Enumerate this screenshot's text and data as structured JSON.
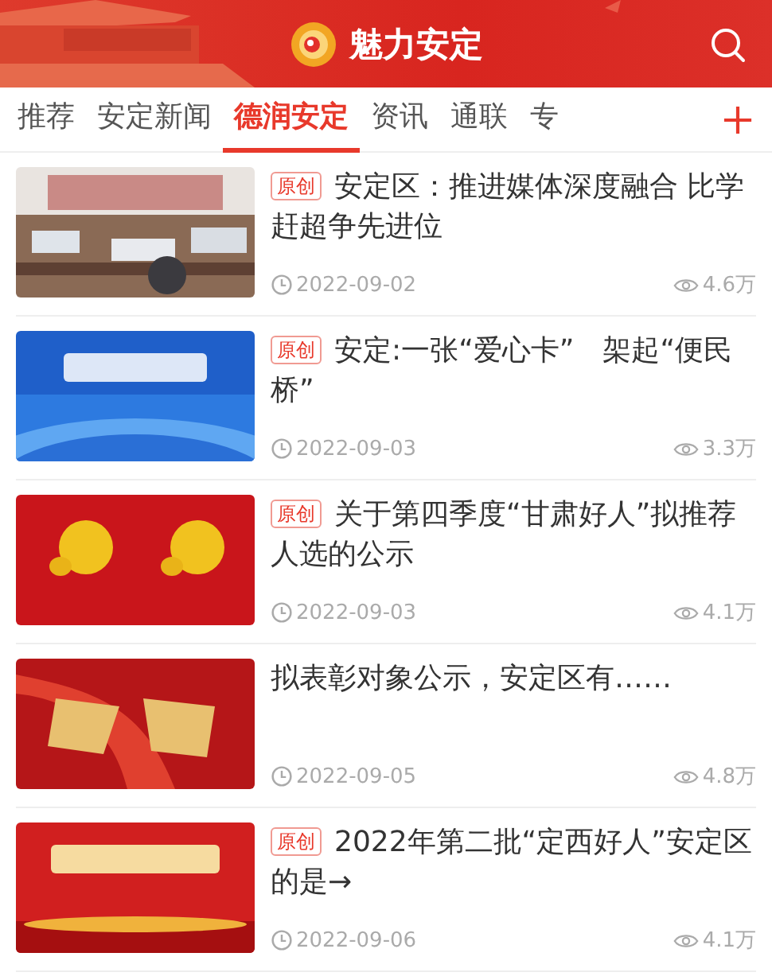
{
  "header": {
    "title": "魅力安定"
  },
  "tabs": [
    {
      "label": "推荐",
      "selected": false
    },
    {
      "label": "安定新闻",
      "selected": false
    },
    {
      "label": "德润安定",
      "selected": true
    },
    {
      "label": "资讯",
      "selected": false
    },
    {
      "label": "通联",
      "selected": false
    },
    {
      "label": "专",
      "selected": false
    }
  ],
  "articles": [
    {
      "badge": "原创",
      "title": "安定区：推进媒体深度融合 比学赶超争先进位",
      "date": "2022-09-02",
      "views": "4.6万"
    },
    {
      "badge": "原创",
      "title": "安定:一张“爱心卡”　架起“便民桥”",
      "date": "2022-09-03",
      "views": "3.3万"
    },
    {
      "badge": "原创",
      "title": "关于第四季度“甘肃好人”拟推荐人选的公示",
      "date": "2022-09-03",
      "views": "4.1万"
    },
    {
      "title": "拟表彰对象公示，安定区有……",
      "date": "2022-09-05",
      "views": "4.8万"
    },
    {
      "badge": "原创",
      "title": "2022年第二批“定西好人”安定区的是→",
      "date": "2022-09-06",
      "views": "4.1万"
    }
  ]
}
